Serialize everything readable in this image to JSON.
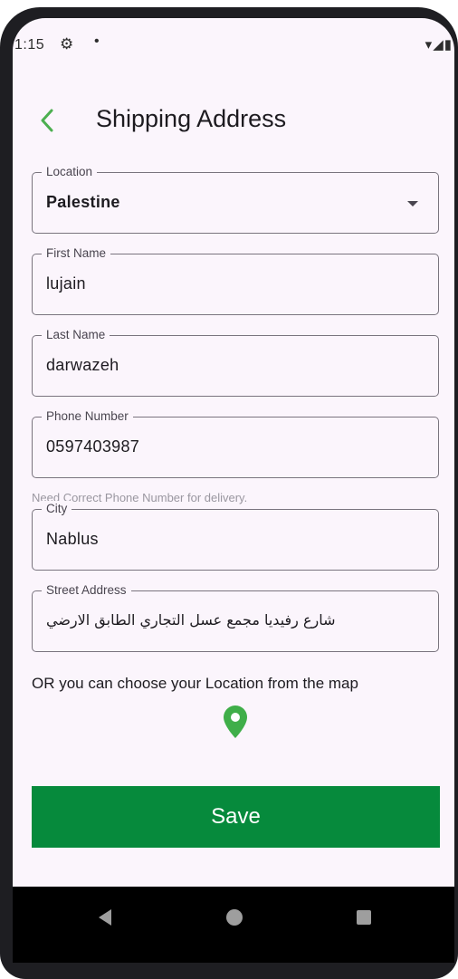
{
  "status_bar": {
    "time": "1:15",
    "gear_icon": "⚙",
    "dot": "•",
    "right_icons": "▾◢▮"
  },
  "header": {
    "title": "Shipping Address",
    "back_icon": "chevron-left-icon"
  },
  "form": {
    "location": {
      "label": "Location",
      "value": "Palestine"
    },
    "first_name": {
      "label": "First Name",
      "value": "lujain"
    },
    "last_name": {
      "label": "Last Name",
      "value": "darwazeh"
    },
    "phone": {
      "label": "Phone Number",
      "value": "0597403987",
      "helper": "Need Correct Phone Number for delivery."
    },
    "city": {
      "label": "City",
      "value": "Nablus"
    },
    "street": {
      "label": "Street Address",
      "value": "شارع رفيديا مجمع عسل التجاري الطابق الارضي"
    }
  },
  "map": {
    "hint": "OR you can choose your Location from the map",
    "pin_icon": "location-pin-icon"
  },
  "actions": {
    "save_label": "Save"
  },
  "colors": {
    "accent": "#068a3c",
    "back_icon": "#4caf50",
    "pin": "#3fae49",
    "background": "#fbf5fc"
  }
}
